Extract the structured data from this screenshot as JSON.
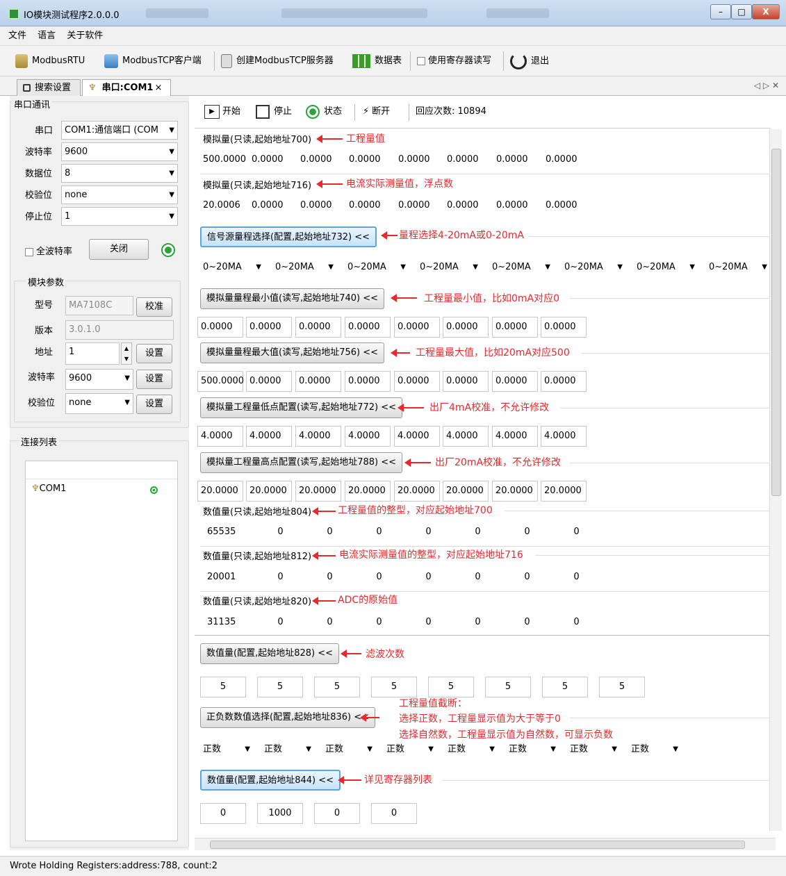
{
  "window": {
    "title": "IO模块测试程序2.0.0.0",
    "min": "–",
    "max": "□",
    "close": "X"
  },
  "menu": [
    "文件",
    "语言",
    "关于软件"
  ],
  "toolbar": {
    "modbusrtu": "ModbusRTU",
    "tcp_client": "ModbusTCP客户端",
    "tcp_server": "创建ModbusTCP服务器",
    "datatable": "数据表",
    "use_reg": "使用寄存器读写",
    "exit": "退出"
  },
  "tabs": {
    "search": "搜索设置",
    "com": "串口:COM1",
    "close": "×",
    "nav": "◁ ▷ ✕"
  },
  "serial": {
    "title": "串口通讯",
    "port_label": "串口",
    "port": "COM1:通信端口 (COM",
    "baud_label": "波特率",
    "baud": "9600",
    "databits_label": "数据位",
    "databits": "8",
    "parity_label": "校验位",
    "parity": "none",
    "stop_label": "停止位",
    "stop": "1",
    "all_baud": "全波特率",
    "close_btn": "关闭"
  },
  "module": {
    "title": "模块参数",
    "model_label": "型号",
    "model": "MA7108C",
    "calib": "校准",
    "version_label": "版本",
    "version": "3.0.1.0",
    "addr_label": "地址",
    "addr": "1",
    "set": "设置",
    "baud_label": "波特率",
    "baud": "9600",
    "parity_label": "校验位",
    "parity": "none"
  },
  "connlist": {
    "title": "连接列表",
    "item": "COM1"
  },
  "ctrl": {
    "start": "开始",
    "stop": "停止",
    "status": "状态",
    "disconnect": "断开",
    "resp": "回应次数: 10894"
  },
  "sec1": {
    "label": "模拟量(只读,起始地址700)",
    "ann": "工程量值",
    "vals": [
      "500.0000",
      "0.0000",
      "0.0000",
      "0.0000",
      "0.0000",
      "0.0000",
      "0.0000",
      "0.0000"
    ]
  },
  "sec2": {
    "label": "模拟量(只读,起始地址716)",
    "ann": "电流实际测量值，浮点数",
    "vals": [
      "20.0006",
      "0.0000",
      "0.0000",
      "0.0000",
      "0.0000",
      "0.0000",
      "0.0000",
      "0.0000"
    ]
  },
  "sec3": {
    "label": "信号源量程选择(配置,起始地址732) <<",
    "ann": "量程选择4-20mA或0-20mA",
    "vals": [
      "0~20MA",
      "0~20MA",
      "0~20MA",
      "0~20MA",
      "0~20MA",
      "0~20MA",
      "0~20MA",
      "0~20MA"
    ]
  },
  "sec4": {
    "label": "模拟量量程最小值(读写,起始地址740) <<",
    "ann": "工程量最小值，比如0mA对应0",
    "vals": [
      "0.0000",
      "0.0000",
      "0.0000",
      "0.0000",
      "0.0000",
      "0.0000",
      "0.0000",
      "0.0000"
    ]
  },
  "sec5": {
    "label": "模拟量量程最大值(读写,起始地址756) <<",
    "ann": "工程量最大值，比如20mA对应500",
    "vals": [
      "500.0000",
      "0.0000",
      "0.0000",
      "0.0000",
      "0.0000",
      "0.0000",
      "0.0000",
      "0.0000"
    ]
  },
  "sec6": {
    "label": "模拟量工程量低点配置(读写,起始地址772) <<",
    "ann": "出厂4mA校准，不允许修改",
    "vals": [
      "4.0000",
      "4.0000",
      "4.0000",
      "4.0000",
      "4.0000",
      "4.0000",
      "4.0000",
      "4.0000"
    ]
  },
  "sec7": {
    "label": "模拟量工程量高点配置(读写,起始地址788) <<",
    "ann": "出厂20mA校准，不允许修改",
    "vals": [
      "20.0000",
      "20.0000",
      "20.0000",
      "20.0000",
      "20.0000",
      "20.0000",
      "20.0000",
      "20.0000"
    ]
  },
  "sec8": {
    "label": "数值量(只读,起始地址804)",
    "ann": "工程量值的整型，对应起始地址700",
    "vals": [
      "65535",
      "0",
      "0",
      "0",
      "0",
      "0",
      "0",
      "0"
    ]
  },
  "sec9": {
    "label": "数值量(只读,起始地址812)",
    "ann": "电流实际测量值的整型，对应起始地址716",
    "vals": [
      "20001",
      "0",
      "0",
      "0",
      "0",
      "0",
      "0",
      "0"
    ]
  },
  "sec10": {
    "label": "数值量(只读,起始地址820)",
    "ann": "ADC的原始值",
    "vals": [
      "31135",
      "0",
      "0",
      "0",
      "0",
      "0",
      "0",
      "0"
    ]
  },
  "sec11": {
    "label": "数值量(配置,起始地址828) <<",
    "ann": "滤波次数",
    "vals": [
      "5",
      "5",
      "5",
      "5",
      "5",
      "5",
      "5",
      "5"
    ]
  },
  "sec12": {
    "label": "正负数数值选择(配置,起始地址836) <<",
    "ann1": "工程量值截断：",
    "ann2": "选择正数，工程量显示值为大于等于0",
    "ann3": "选择自然数，工程量显示值为自然数，可显示负数",
    "vals": [
      "正数",
      "正数",
      "正数",
      "正数",
      "正数",
      "正数",
      "正数",
      "正数"
    ]
  },
  "sec13": {
    "label": "数值量(配置,起始地址844) <<",
    "ann": "详见寄存器列表",
    "vals": [
      "0",
      "1000",
      "0",
      "0"
    ]
  },
  "status": "Wrote Holding Registers:address:788, count:2"
}
